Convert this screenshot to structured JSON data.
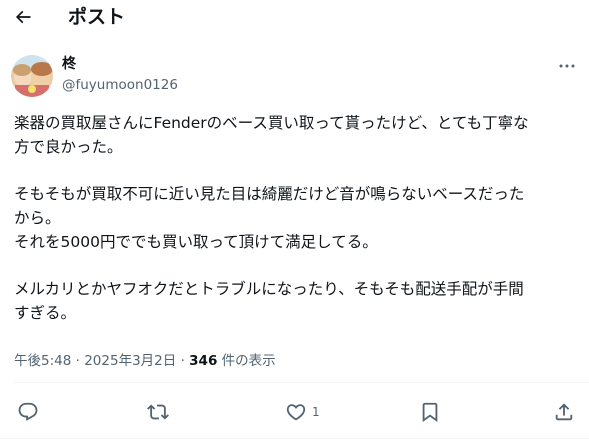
{
  "header": {
    "title": "ポスト",
    "back_icon": "arrow-left-icon"
  },
  "author": {
    "display_name": "柊",
    "handle": "@fuyumoon0126",
    "avatar_icon": "user-avatar"
  },
  "tweet": {
    "lines": [
      "楽器の買取屋さんにFenderのベース買い取って貰ったけど、とても丁寧な",
      "方で良かった。",
      "",
      "そもそもが買取不可に近い見た目は綺麗だけど音が鳴らないベースだった",
      "から。",
      "それを5000円ででも買い取って頂けて満足してる。",
      "",
      "メルカリとかヤフオクだとトラブルになったり、そもそも配送手配が手間",
      "すぎる。"
    ]
  },
  "meta": {
    "time": "午後5:48",
    "separator": "·",
    "date": "2025年3月2日",
    "views_count": "346",
    "views_label": "件の表示"
  },
  "actions": {
    "reply_icon": "reply-icon",
    "retweet_icon": "retweet-icon",
    "like_icon": "heart-icon",
    "like_count": "1",
    "bookmark_icon": "bookmark-icon",
    "share_icon": "share-icon"
  },
  "colors": {
    "text": "#0f1419",
    "secondary": "#536471",
    "divider": "#eff3f4"
  }
}
